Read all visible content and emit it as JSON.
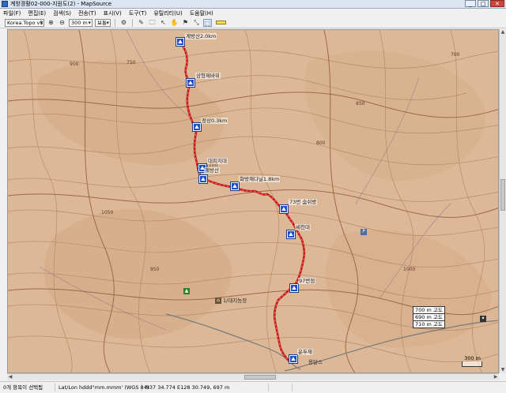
{
  "window": {
    "title": "계방경활02-000-지원도(2) - MapSource",
    "min": "_",
    "max": "□",
    "close": "✕"
  },
  "menu": [
    "파일(F)",
    "편집(E)",
    "검색(S)",
    "전송(T)",
    "표시(V)",
    "도구(T)",
    "유틸리티(U)",
    "도움말(H)"
  ],
  "toolbar": {
    "map_product": "Korea.Topo v3",
    "scale": "300 m",
    "style": "보통",
    "zoom_in": "⊕",
    "zoom_out": "⊖",
    "icons": [
      "⚙",
      "✎",
      "🗀",
      "↖",
      "✋",
      "⚑",
      "⤡",
      "⬚"
    ]
  },
  "map": {
    "colors": {
      "terrain": "#dcb897",
      "contour": "#b88a66",
      "contour_major": "#9c6a47",
      "track": "#c81818",
      "road": "#7a7a7a",
      "waypoint": "#1b4ec7"
    },
    "waypoints": [
      {
        "label": "계방산2.0km"
      },
      {
        "label": "삼형제바위"
      },
      {
        "label": "정상0.3km"
      },
      {
        "label": "대피지대"
      },
      {
        "label": "계방산"
      },
      {
        "label": "화방재다닐1.8km"
      },
      {
        "label": "73번 숨쉬방"
      },
      {
        "label": "세천대"
      },
      {
        "label": "97번점"
      },
      {
        "label": "운두재"
      }
    ],
    "poi": {
      "farm": "1/대지농장",
      "cabin": "용달스"
    },
    "peaks": [
      "900",
      "750",
      "1050",
      "1100",
      "850",
      "950",
      "700",
      "800",
      "1000"
    ],
    "altitudes": [
      "700 m 고도",
      "690 m 고도",
      "710 m 고도"
    ],
    "scale_label": "300 m"
  },
  "status": {
    "selection": "0개 항목이 선택됨",
    "format": "Lat/Lon hddd°mm.mmm' (WGS 84)",
    "coords": "N37 34.774 E128 30.749, 697 m"
  }
}
